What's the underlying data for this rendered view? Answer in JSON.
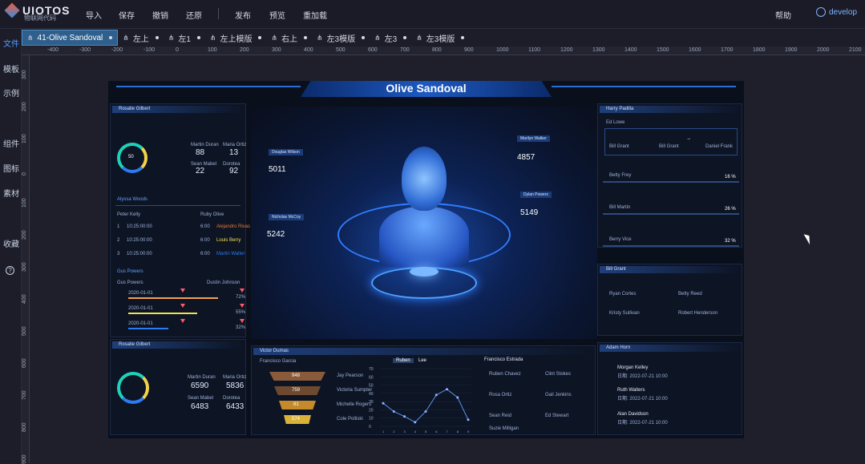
{
  "app": {
    "logo_text": "UIOTOS",
    "logo_sub": "物联网代码"
  },
  "topbar": {
    "menus": [
      "导入",
      "保存",
      "撤销",
      "还原",
      "发布",
      "预览",
      "重加载"
    ],
    "help": "帮助",
    "user": "develop"
  },
  "leftbar": {
    "items": [
      "文件",
      "模板",
      "示例",
      "组件",
      "图标",
      "素材",
      "收藏"
    ],
    "help_icon": "?"
  },
  "tabs": [
    {
      "label": "41-Olive Sandoval",
      "icon": "share-icon"
    },
    {
      "label": "左上",
      "icon": "share-icon"
    },
    {
      "label": "左1",
      "icon": "share-icon"
    },
    {
      "label": "左上模版",
      "icon": "share-icon"
    },
    {
      "label": "右上",
      "icon": "share-icon"
    },
    {
      "label": "左3模版",
      "icon": "share-icon"
    },
    {
      "label": "左3",
      "icon": "share-icon"
    },
    {
      "label": "左3模版",
      "icon": "share-icon"
    }
  ],
  "ruler": {
    "ticks": [
      "-400",
      "-300",
      "-200",
      "-100",
      "0",
      "100",
      "200",
      "300",
      "400",
      "500",
      "600",
      "700",
      "800",
      "900",
      "1000",
      "1100",
      "1200",
      "1300",
      "1400",
      "1500",
      "1600",
      "1700",
      "1800",
      "1900",
      "2000",
      "2100"
    ],
    "vticks": [
      "300",
      "200",
      "100",
      "0",
      "100",
      "200",
      "300",
      "400",
      "500",
      "600",
      "700",
      "800",
      "900"
    ]
  },
  "dashboard": {
    "title": "Olive Sandoval",
    "left_top": {
      "title": "Rosalie Gilbert",
      "gauge_label": "50",
      "stats": [
        {
          "label": "Martin Duran",
          "value": "88"
        },
        {
          "label": "Maria Ortiz",
          "value": "13"
        },
        {
          "label": "Sean Mabel",
          "value": "22"
        },
        {
          "label": "Dorotea",
          "value": "92"
        }
      ],
      "sub_title": "Alyssa Woods",
      "table_header": [
        "Peter Kelly",
        "Ruby Olive"
      ],
      "rows": [
        {
          "n": "1",
          "time": "10:25:00:00",
          "v": "6:00",
          "name": "Alejandro Rivas"
        },
        {
          "n": "2",
          "time": "10:25:00:00",
          "v": "6:00",
          "name": "Louis Berry"
        },
        {
          "n": "3",
          "time": "10:25:00:00",
          "v": "6:00",
          "name": "Martin Walter"
        }
      ],
      "sub_title2": "Gus Powers",
      "sub_cols": [
        "Gus Powers",
        "Dustin Johnson"
      ],
      "bars": [
        {
          "label": "2020-01-01",
          "value": "72%",
          "color": "#f7a04b"
        },
        {
          "label": "2020-01-01",
          "value": "55%",
          "color": "#f2e24b"
        },
        {
          "label": "2020-01-01",
          "value": "32%",
          "color": "#2d7bf0"
        }
      ]
    },
    "left_bottom": {
      "title": "Rosalie Gilbert",
      "stats": [
        {
          "label": "Martin Duran",
          "value": "6590"
        },
        {
          "label": "Maria Ortiz",
          "value": "5836"
        },
        {
          "label": "Sean Mabel",
          "value": "6483"
        },
        {
          "label": "Dorotea",
          "value": "6433"
        }
      ]
    },
    "center_tags": [
      {
        "label": "Douglas Wilson",
        "value": "5011"
      },
      {
        "label": "Marilyn Walker",
        "value": "4857"
      },
      {
        "label": "Dylan Powers",
        "value": "5149"
      },
      {
        "label": "Nicholas McCoy",
        "value": "5242"
      }
    ],
    "right_top": {
      "title": "Harry Padilla",
      "sub": "Ed Lowe",
      "flow_labels": [
        "Bill Grant",
        "Bill Grant",
        "Daniel Frank"
      ],
      "items": [
        {
          "label": "Betty Frey",
          "value": "16 %"
        },
        {
          "label": "Bill Martin",
          "value": "26 %"
        },
        {
          "label": "Berry Vice",
          "value": "32 %"
        }
      ]
    },
    "right_mid": {
      "title": "Bill Grant",
      "items": [
        "Ryan Cortes",
        "Betty Reed",
        "Kristy Sullivan",
        "Robert Henderson"
      ]
    },
    "right_bottom": {
      "title": "Adam Horn",
      "items": [
        {
          "name": "Morgan Kelley",
          "time": "日期: 2022-07-21 10:00"
        },
        {
          "name": "Ruth Walters",
          "time": "日期: 2022-07-21 10:00"
        },
        {
          "name": "Alan Davidson",
          "time": "日期: 2022-07-21 10:00"
        }
      ]
    },
    "bottom_center": {
      "title": "Victor Dumas",
      "funnel_title": "Francisco Garcia",
      "funnel": [
        {
          "value": "948",
          "label": "Jay Pearson"
        },
        {
          "value": "759",
          "label": "Victoria Sumpter"
        },
        {
          "value": "81",
          "label": "Michelle Rogers"
        },
        {
          "value": "574",
          "label": "Cole Polliski"
        }
      ],
      "chart_tabs": [
        "Ruben",
        "Lee"
      ],
      "yticks": [
        "70",
        "60",
        "50",
        "40",
        "30",
        "20",
        "10",
        "0"
      ],
      "list_title": "Francisco Estrada",
      "list": [
        {
          "a": "Ruben Chavez",
          "b": "Clint Stokes"
        },
        {
          "a": "Rosa Ortiz",
          "b": "Gail Jenkins"
        },
        {
          "a": "Sean Reid",
          "b": "Ed Stewart"
        },
        {
          "a": "Suzie Milligan",
          "b": ""
        }
      ]
    }
  },
  "chart_data": {
    "type": "line",
    "x": [
      "1",
      "2",
      "3",
      "4",
      "5",
      "6",
      "7",
      "8",
      "9"
    ],
    "series": [
      {
        "values": [
          28,
          18,
          12,
          5,
          18,
          38,
          45,
          35,
          8
        ]
      }
    ],
    "ylim": [
      0,
      70
    ]
  }
}
